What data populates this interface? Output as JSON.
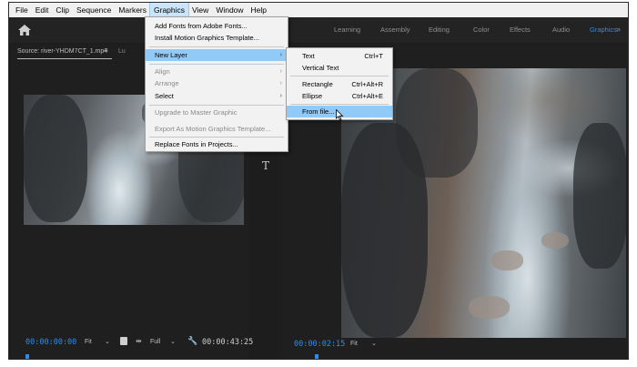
{
  "menubar": {
    "items": [
      "File",
      "Edit",
      "Clip",
      "Sequence",
      "Markers",
      "Graphics",
      "View",
      "Window",
      "Help"
    ],
    "active": "Graphics"
  },
  "workspace": {
    "tabs": [
      "Learning",
      "Assembly",
      "Editing",
      "Color",
      "Effects",
      "Audio",
      "Graphics"
    ],
    "active_tab": "Graphics",
    "more": "»"
  },
  "source": {
    "tab_label": "Source: river-YHDM7CT_1.mp4",
    "tab_menu": "≡",
    "tab2_label": "Lu",
    "timecode": "00:00:00:00",
    "fit": "Fit",
    "full": "Full",
    "duration": "00:00:43:25"
  },
  "program": {
    "timecode": "00:00:02:15",
    "fit": "Fit"
  },
  "graphics_menu": {
    "items": [
      {
        "label": "Add Fonts from Adobe Fonts...",
        "disabled": false
      },
      {
        "label": "Install Motion Graphics Template...",
        "disabled": false
      },
      {
        "label": "New Layer",
        "disabled": false,
        "submenu": true,
        "highlight": true
      },
      {
        "label": "Align",
        "disabled": true,
        "submenu": true
      },
      {
        "label": "Arrange",
        "disabled": true,
        "submenu": true
      },
      {
        "label": "Select",
        "disabled": false,
        "submenu": true
      },
      {
        "label": "Upgrade to Master Graphic",
        "disabled": true
      },
      {
        "label": "Export As Motion Graphics Template...",
        "disabled": true
      },
      {
        "label": "Replace Fonts in Projects...",
        "disabled": false
      }
    ]
  },
  "new_layer_menu": {
    "items": [
      {
        "label": "Text",
        "shortcut": "Ctrl+T"
      },
      {
        "label": "Vertical Text",
        "shortcut": ""
      },
      {
        "label": "Rectangle",
        "shortcut": "Ctrl+Alt+R"
      },
      {
        "label": "Ellipse",
        "shortcut": "Ctrl+Alt+E"
      },
      {
        "label": "From file...",
        "shortcut": "",
        "highlight": true
      }
    ]
  },
  "colors": {
    "accent_blue": "#2d8ceb",
    "menu_highlight": "#91c9f7",
    "panel_bg": "#1f1f1f"
  },
  "text_tool": "T"
}
